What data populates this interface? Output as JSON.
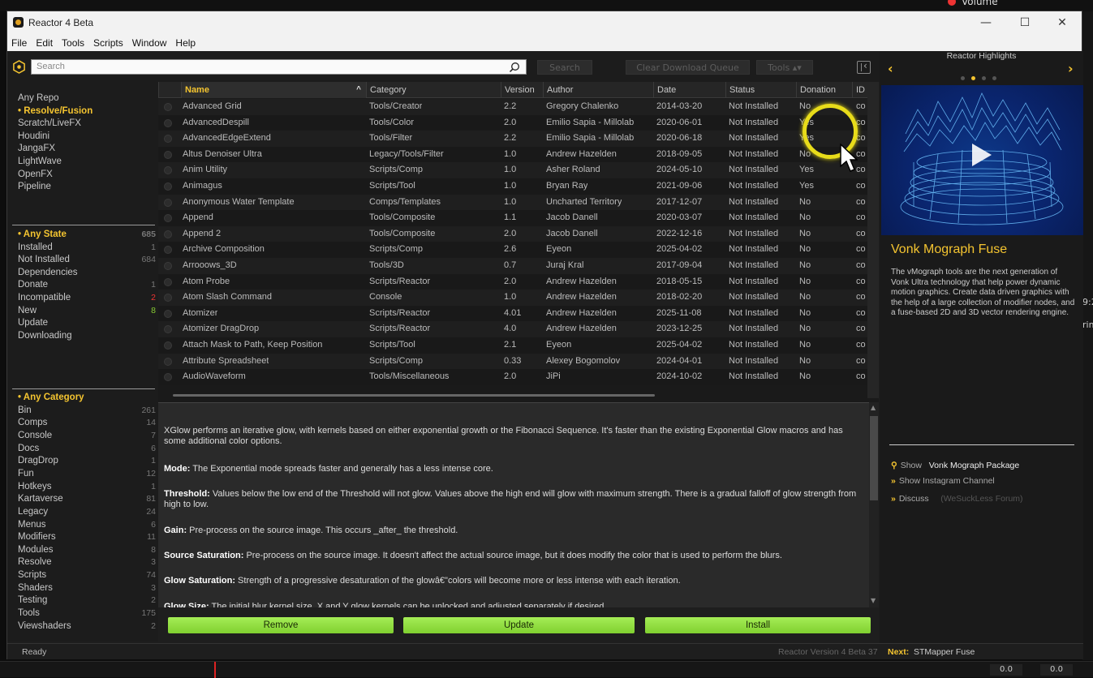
{
  "background": {
    "volume_label": "Volume",
    "right_fragment_1": "9:2",
    "right_fragment_2": "rim",
    "timecode_1": "0.0",
    "timecode_2": "0.0"
  },
  "window": {
    "title": "Reactor 4 Beta",
    "controls": {
      "minimize": "—",
      "maximize": "☐",
      "close": "✕"
    }
  },
  "menu": [
    "File",
    "Edit",
    "Tools",
    "Scripts",
    "Window",
    "Help"
  ],
  "toolbar": {
    "search_placeholder": "Search",
    "search_button": "Search",
    "clear_queue_button": "Clear Download Queue",
    "tools_button": "Tools ▴▾"
  },
  "sidebar": {
    "repos": [
      {
        "label": "Any Repo",
        "active": false
      },
      {
        "label": "Resolve/Fusion",
        "active": true
      },
      {
        "label": "Scratch/LiveFX",
        "active": false
      },
      {
        "label": "Houdini",
        "active": false
      },
      {
        "label": "JangaFX",
        "active": false
      },
      {
        "label": "LightWave",
        "active": false
      },
      {
        "label": "OpenFX",
        "active": false
      },
      {
        "label": "Pipeline",
        "active": false
      }
    ],
    "states": [
      {
        "label": "Any State",
        "count": "685",
        "active": true,
        "tone": ""
      },
      {
        "label": "Installed",
        "count": "1",
        "active": false,
        "tone": ""
      },
      {
        "label": "Not Installed",
        "count": "684",
        "active": false,
        "tone": ""
      },
      {
        "label": "Dependencies",
        "count": "",
        "active": false,
        "tone": ""
      },
      {
        "label": "Donate",
        "count": "1",
        "active": false,
        "tone": ""
      },
      {
        "label": "Incompatible",
        "count": "2",
        "active": false,
        "tone": "red"
      },
      {
        "label": "New",
        "count": "8",
        "active": false,
        "tone": "green"
      },
      {
        "label": "Update",
        "count": "",
        "active": false,
        "tone": ""
      },
      {
        "label": "Downloading",
        "count": "",
        "active": false,
        "tone": ""
      }
    ],
    "categories": [
      {
        "label": "Any Category",
        "count": "",
        "active": true
      },
      {
        "label": "Bin",
        "count": "261",
        "active": false
      },
      {
        "label": "Comps",
        "count": "14",
        "active": false
      },
      {
        "label": "Console",
        "count": "7",
        "active": false
      },
      {
        "label": "Docs",
        "count": "6",
        "active": false
      },
      {
        "label": "DragDrop",
        "count": "1",
        "active": false
      },
      {
        "label": "Fun",
        "count": "12",
        "active": false
      },
      {
        "label": "Hotkeys",
        "count": "1",
        "active": false
      },
      {
        "label": "Kartaverse",
        "count": "81",
        "active": false
      },
      {
        "label": "Legacy",
        "count": "24",
        "active": false
      },
      {
        "label": "Menus",
        "count": "6",
        "active": false
      },
      {
        "label": "Modifiers",
        "count": "11",
        "active": false
      },
      {
        "label": "Modules",
        "count": "8",
        "active": false
      },
      {
        "label": "Resolve",
        "count": "3",
        "active": false
      },
      {
        "label": "Scripts",
        "count": "74",
        "active": false
      },
      {
        "label": "Shaders",
        "count": "3",
        "active": false
      },
      {
        "label": "Testing",
        "count": "2",
        "active": false
      },
      {
        "label": "Tools",
        "count": "175",
        "active": false
      },
      {
        "label": "Viewshaders",
        "count": "2",
        "active": false
      }
    ]
  },
  "table": {
    "columns": [
      "Name",
      "Category",
      "Version",
      "Author",
      "Date",
      "Status",
      "Donation",
      "ID"
    ],
    "sort_indicator": "^",
    "rows": [
      {
        "name": "Advanced Grid",
        "category": "Tools/Creator",
        "version": "2.2",
        "author": "Gregory Chalenko",
        "date": "2014-03-20",
        "status": "Not Installed",
        "donation": "No",
        "id": "co"
      },
      {
        "name": "AdvancedDespill",
        "category": "Tools/Color",
        "version": "2.0",
        "author": "Emilio Sapia - Millolab",
        "date": "2020-06-01",
        "status": "Not Installed",
        "donation": "Yes",
        "id": "co"
      },
      {
        "name": "AdvancedEdgeExtend",
        "category": "Tools/Filter",
        "version": "2.2",
        "author": "Emilio Sapia - Millolab",
        "date": "2020-06-18",
        "status": "Not Installed",
        "donation": "Yes",
        "id": "co"
      },
      {
        "name": "Altus Denoiser Ultra",
        "category": "Legacy/Tools/Filter",
        "version": "1.0",
        "author": "Andrew Hazelden",
        "date": "2018-09-05",
        "status": "Not Installed",
        "donation": "No",
        "id": "co"
      },
      {
        "name": "Anim Utility",
        "category": "Scripts/Comp",
        "version": "1.0",
        "author": "Asher Roland",
        "date": "2024-05-10",
        "status": "Not Installed",
        "donation": "Yes",
        "id": "co"
      },
      {
        "name": "Animagus",
        "category": "Scripts/Tool",
        "version": "1.0",
        "author": "Bryan Ray",
        "date": "2021-09-06",
        "status": "Not Installed",
        "donation": "Yes",
        "id": "co"
      },
      {
        "name": "Anonymous Water Template",
        "category": "Comps/Templates",
        "version": "1.0",
        "author": "Uncharted Territory",
        "date": "2017-12-07",
        "status": "Not Installed",
        "donation": "No",
        "id": "co"
      },
      {
        "name": "Append",
        "category": "Tools/Composite",
        "version": "1.1",
        "author": "Jacob Danell",
        "date": "2020-03-07",
        "status": "Not Installed",
        "donation": "No",
        "id": "co"
      },
      {
        "name": "Append 2",
        "category": "Tools/Composite",
        "version": "2.0",
        "author": "Jacob Danell",
        "date": "2022-12-16",
        "status": "Not Installed",
        "donation": "No",
        "id": "co"
      },
      {
        "name": "Archive Composition",
        "category": "Scripts/Comp",
        "version": "2.6",
        "author": "Eyeon",
        "date": "2025-04-02",
        "status": "Not Installed",
        "donation": "No",
        "id": "co"
      },
      {
        "name": "Arrooows_3D",
        "category": "Tools/3D",
        "version": "0.7",
        "author": "Juraj Kral",
        "date": "2017-09-04",
        "status": "Not Installed",
        "donation": "No",
        "id": "co"
      },
      {
        "name": "Atom Probe",
        "category": "Scripts/Reactor",
        "version": "2.0",
        "author": "Andrew Hazelden",
        "date": "2018-05-15",
        "status": "Not Installed",
        "donation": "No",
        "id": "co"
      },
      {
        "name": "Atom Slash Command",
        "category": "Console",
        "version": "1.0",
        "author": "Andrew Hazelden",
        "date": "2018-02-20",
        "status": "Not Installed",
        "donation": "No",
        "id": "co"
      },
      {
        "name": "Atomizer",
        "category": "Scripts/Reactor",
        "version": "4.01",
        "author": "Andrew Hazelden",
        "date": "2025-11-08",
        "status": "Not Installed",
        "donation": "No",
        "id": "co"
      },
      {
        "name": "Atomizer DragDrop",
        "category": "Scripts/Reactor",
        "version": "4.0",
        "author": "Andrew Hazelden",
        "date": "2023-12-25",
        "status": "Not Installed",
        "donation": "No",
        "id": "co"
      },
      {
        "name": "Attach Mask to Path, Keep Position",
        "category": "Scripts/Tool",
        "version": "2.1",
        "author": "Eyeon",
        "date": "2025-04-02",
        "status": "Not Installed",
        "donation": "No",
        "id": "co"
      },
      {
        "name": "Attribute Spreadsheet",
        "category": "Scripts/Comp",
        "version": "0.33",
        "author": "Alexey Bogomolov",
        "date": "2024-04-01",
        "status": "Not Installed",
        "donation": "No",
        "id": "co"
      },
      {
        "name": "AudioWaveform",
        "category": "Tools/Miscellaneous",
        "version": "2.0",
        "author": "JiPi",
        "date": "2024-10-02",
        "status": "Not Installed",
        "donation": "No",
        "id": "co"
      }
    ]
  },
  "description": [
    {
      "head": "",
      "body": "XGlow performs an iterative glow, with kernels based on either exponential growth or the Fibonacci Sequence. It's faster than the existing Exponential Glow macros and has some additional color options."
    },
    {
      "head": "Mode:",
      "body": " The Exponential mode spreads faster and generally has a less intense core."
    },
    {
      "head": "Threshold:",
      "body": " Values below the low end of the Threshold will not glow. Values above the high end will glow with maximum strength. There is a gradual falloff of glow strength from high to low."
    },
    {
      "head": "Gain:",
      "body": " Pre-process on the source image. This occurs _after_ the threshold."
    },
    {
      "head": "Source Saturation:",
      "body": " Pre-process on the source image. It doesn't affect the actual source image, but it does modify the color that is used to perform the blurs."
    },
    {
      "head": "Glow Saturation:",
      "body": " Strength of a progressive desaturation of the glowâ€\"colors will become more or less intense with each iteration."
    },
    {
      "head": "Glow Size:",
      "body": " The initial blur kernel size. X and Y glow kernels can be unlocked and adjusted separately if desired."
    }
  ],
  "actions": {
    "remove": "Remove",
    "update": "Update",
    "install": "Install"
  },
  "status": {
    "ready": "Ready",
    "version": "Reactor Version 4 Beta 37",
    "next_label": "Next:",
    "next_value": "STMapper Fuse"
  },
  "highlights": {
    "title": "Reactor Highlights",
    "prev_arrow": "‹",
    "next_arrow": "›",
    "current_slide": 2,
    "slide_count": 4,
    "heading": "Vonk Mograph Fuse",
    "text": "The vMograph tools are the next generation of Vonk Ultra technology that help power dynamic motion graphics. Create data driven graphics with the help of a large collection of modifier nodes, and a fuse-based 2D and 3D vector rendering engine.",
    "show_label": "Show",
    "package_name": "Vonk Mograph",
    "package_suffix": "Package",
    "instagram": "Show Instagram Channel",
    "discuss": "Discuss",
    "discuss_forum": "(WeSuckLess Forum)"
  },
  "colors": {
    "accent": "#f4c430",
    "button_green": "#8fdc3d",
    "incompatible_red": "#e33333",
    "new_green": "#88cc33"
  }
}
